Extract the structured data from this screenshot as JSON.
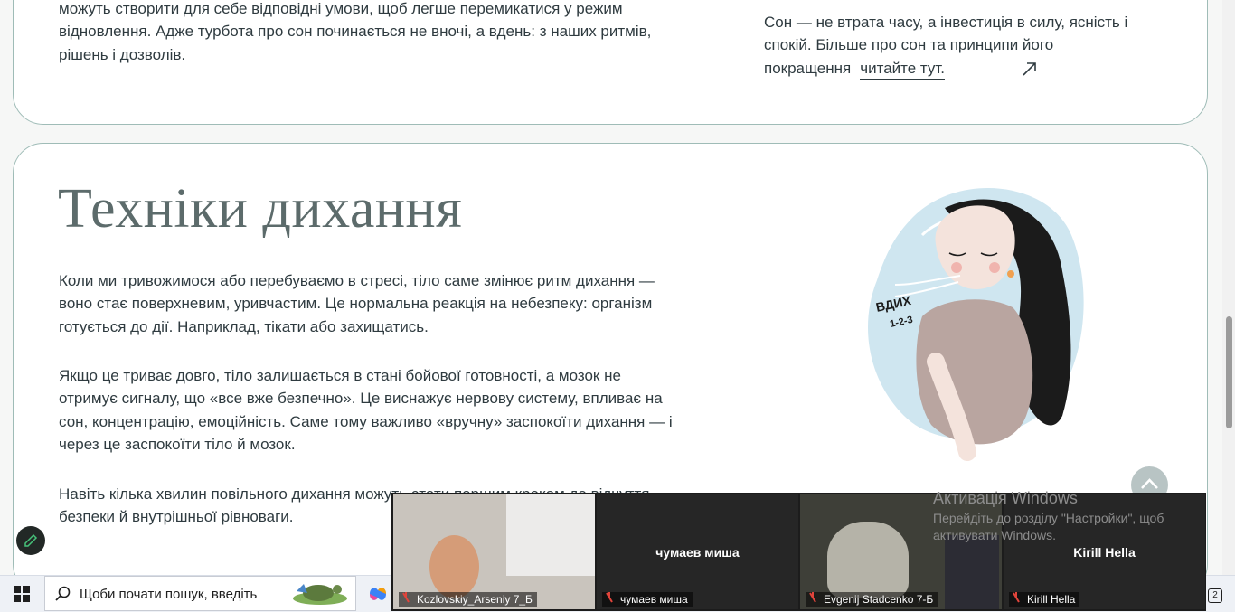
{
  "sleep_section": {
    "text_left": "можуть створити для себе відповідні умови, щоб легше перемикатися у режим відновлення. Адже турбота про сон починається не вночі, а вдень: з наших ритмів, рішень і дозволів.",
    "text_right": "Сон — не втрата часу, а інвестиція в силу, ясність і спокій. Більше про сон та принципи його покращення",
    "link_label": "читайте тут.",
    "arrow_icon": "arrow-up-right-icon"
  },
  "breathing_section": {
    "title": "Техніки дихання",
    "paragraphs": [
      "Коли ми тривожимося або перебуваємо в стресі, тіло саме змінює ритм дихання — воно стає поверхневим, уривчастим. Це нормальна реакція на небезпеку: організм готується до дії. Наприклад, тікати або захищатись.",
      "Якщо це триває довго, тіло залишається в стані бойової готовності, а мозок не отримує сигналу, що «все вже безпечно». Це виснажує нервову систему, впливає на сон, концентрацію, емоційність. Саме тому важливо «вручну» заспокоїти дихання — і через це заспокоїти тіло й мозок.",
      "Навіть кілька хвилин повільного дихання можуть стати першим кроком до відчуття безпеки й внутрішньої рівноваги."
    ],
    "illustration": {
      "text_line1": "ВДИХ",
      "text_line2": "1-2-3"
    }
  },
  "windows_activation": {
    "title": "Активація Windows",
    "line1": "Перейдіть до розділу \"Настройки\", щоб",
    "line2": "активувати Windows."
  },
  "taskbar": {
    "search_placeholder": "Щоби почати пошук, введіть",
    "icons": [
      "windows-start-icon",
      "search-icon",
      "copilot-icon"
    ],
    "notification_count": "2"
  },
  "zoom_panel": {
    "participants": [
      {
        "label": "Kozlovskiy_Arseniy 7_Б",
        "center_name": "",
        "video": true
      },
      {
        "label": "чумаев миша",
        "center_name": "чумаев миша",
        "video": false
      },
      {
        "label": "Evgenij Stadcenko 7-Б",
        "center_name": "",
        "video": true
      },
      {
        "label": "Kirill Hella",
        "center_name": "Kirill Hella",
        "video": false
      }
    ]
  },
  "colors": {
    "card_border": "#9fbcb7",
    "heading": "#5c6b6b",
    "body_text": "#2f3b40",
    "illustration_bg": "#cfe6f0"
  }
}
